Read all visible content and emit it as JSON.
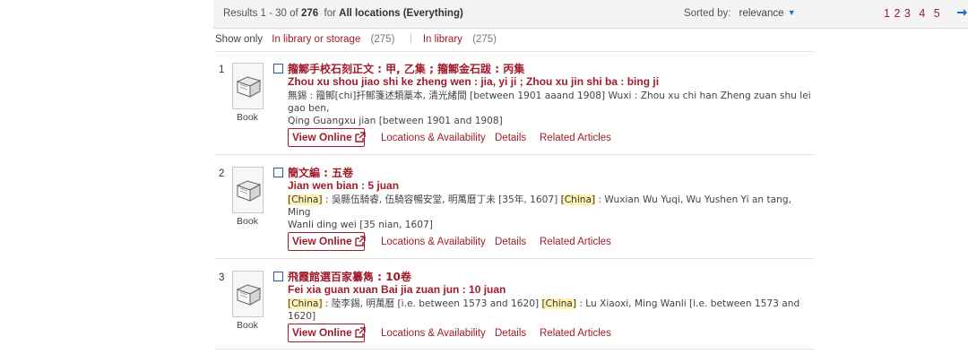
{
  "header": {
    "results_prefix": "Results 1 - 30 of",
    "total": "276",
    "for_label": "for",
    "scope": "All locations (Everything)",
    "sort_label": "Sorted by:",
    "sort_value": "relevance",
    "pages": [
      "1",
      "2",
      "3",
      "4",
      "5"
    ]
  },
  "filter": {
    "label": "Show only",
    "options": [
      {
        "label": "In library or storage",
        "count": "(275)"
      },
      {
        "label": "In library",
        "count": "(275)"
      }
    ]
  },
  "records": [
    {
      "num": "1",
      "title_orig": "籀鄦手校石刻正文 : 甲, 乙集 ; 籀鄦金石跋 : 丙集",
      "title_rom": "Zhou xu shou jiao shi ke zheng wen : jia, yi ji ; Zhou xu jin shi ba : bing ji",
      "pub_line1": "無錫 : 籀鄦[chi]扞鄦箋述類藁本, 清光緒間 [between 1901 aaand 1908] Wuxi : Zhou xu chi han Zheng zuan shu lei gao ben,",
      "pub_line2": "Qing Guangxu jian [between 1901 and 1908]",
      "format": "Book",
      "view_label": "View Online",
      "locations_label": "Locations & Availability",
      "details_label": "Details",
      "related_label": "Related Articles"
    },
    {
      "num": "2",
      "title_orig": "簡文編 : 五卷",
      "title_rom": "Jian wen bian : 5 juan",
      "hl1": "[China]",
      "pub_a": " : 吳縣伍騎睿, 伍騎容暢安堂, 明萬曆丁未 [35年, 1607] ",
      "hl2": "[China]",
      "pub_b": " : Wuxian Wu Yuqi, Wu Yushen Yi an tang, Ming",
      "pub_line2": "Wanli ding wei [35 nian, 1607]",
      "format": "Book",
      "view_label": "View Online",
      "locations_label": "Locations & Availability",
      "details_label": "Details",
      "related_label": "Related Articles"
    },
    {
      "num": "3",
      "title_orig": "飛霞館選百家纂雋 : 10卷",
      "title_rom": "Fei xia guan xuan Bai jia zuan jun : 10 juan",
      "hl1": "[China]",
      "pub_a": " : 陸李錫, 明萬曆 [i.e. between 1573 and 1620] ",
      "hl2": "[China]",
      "pub_b": " : Lu Xiaoxi, Ming Wanli [i.e. between 1573 and 1620]",
      "format": "Book",
      "view_label": "View Online",
      "locations_label": "Locations & Availability",
      "details_label": "Details",
      "related_label": "Related Articles"
    }
  ],
  "colors": {
    "accent": "#a11c2b",
    "link_blue": "#1a6fd0",
    "highlight": "#fff2b3"
  },
  "icons": {
    "sort": "chevron-down-icon",
    "next": "arrow-right-icon",
    "format": "book-icon",
    "external": "external-link-icon"
  }
}
